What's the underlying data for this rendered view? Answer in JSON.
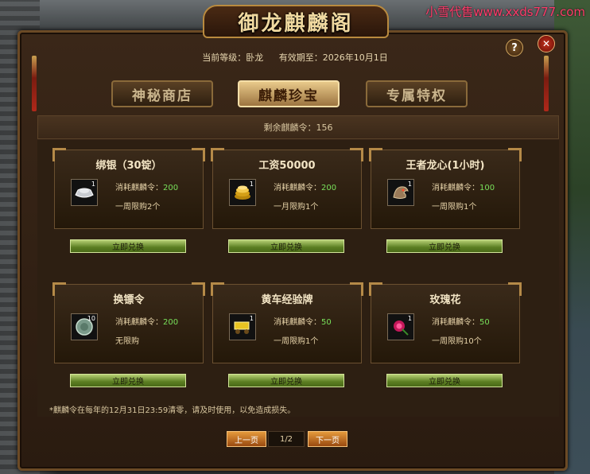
{
  "watermark": "小雪代售www.xxds777.com",
  "window": {
    "title": "御龙麒麟阁",
    "help_label": "?",
    "close_label": "✕"
  },
  "info": {
    "level_label": "当前等级：卧龙",
    "expiry_label": "有效期至：2026年10月1日"
  },
  "tabs": [
    {
      "label": "神秘商店",
      "active": false
    },
    {
      "label": "麒麟珍宝",
      "active": true
    },
    {
      "label": "专属特权",
      "active": false
    }
  ],
  "remaining": "剩余麒麟令：156",
  "items": [
    {
      "name": "绑银（30锭）",
      "icon": "silver-ingot-icon",
      "count": "1",
      "cost_label": "消耗麒麟令：",
      "cost": "200",
      "limit": "一周限购2个",
      "button": "立即兑换"
    },
    {
      "name": "工资50000",
      "icon": "gold-coins-icon",
      "count": "1",
      "cost_label": "消耗麒麟令：",
      "cost": "200",
      "limit": "一月限购1个",
      "button": "立即兑换"
    },
    {
      "name": "王者龙心(1小时)",
      "icon": "dragon-heart-icon",
      "count": "1",
      "cost_label": "消耗麒麟令：",
      "cost": "100",
      "limit": "一周限购1个",
      "button": "立即兑换"
    },
    {
      "name": "换镖令",
      "icon": "escort-token-icon",
      "count": "10",
      "cost_label": "消耗麒麟令：",
      "cost": "200",
      "limit": "无限购",
      "button": "立即兑换"
    },
    {
      "name": "黄车经验牌",
      "icon": "yellow-cart-icon",
      "count": "1",
      "cost_label": "消耗麒麟令：",
      "cost": "50",
      "limit": "一周限购1个",
      "button": "立即兑换"
    },
    {
      "name": "玫瑰花",
      "icon": "rose-icon",
      "count": "1",
      "cost_label": "消耗麒麟令：",
      "cost": "50",
      "limit": "一周限购10个",
      "button": "立即兑换"
    }
  ],
  "note": "*麒麟令在每年的12月31日23:59清零，请及时使用，以免造成损失。",
  "pagination": {
    "prev": "上一页",
    "page": "1/2",
    "next": "下一页"
  },
  "colors": {
    "cost_value": "#78e05a",
    "active_tab": "#e8c98a",
    "watermark": "#ff3b6a"
  }
}
